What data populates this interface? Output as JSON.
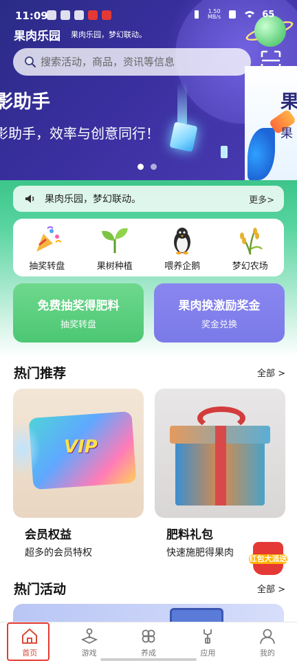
{
  "status_bar": {
    "time": "11:09",
    "net_speed": "1.50",
    "net_unit": "MB/s",
    "battery": "65"
  },
  "header": {
    "brand": "果肉乐园",
    "slogan": "果肉乐园，梦幻联动。"
  },
  "search": {
    "placeholder": "搜索活动，商品，资讯等信息",
    "icon": "search-icon"
  },
  "banner": {
    "title": "影助手",
    "subtitle": "影助手，效率与创意同行！",
    "next_title": "果",
    "next_subtitle": "果",
    "slides": 2,
    "active_slide": 1
  },
  "notice": {
    "text": "果肉乐园，梦幻联动。",
    "more": "更多>"
  },
  "quick_entries": [
    {
      "label": "抽奖转盘",
      "icon": "party-popper-icon"
    },
    {
      "label": "果树种植",
      "icon": "seedling-icon"
    },
    {
      "label": "喂养企鹅",
      "icon": "penguin-icon"
    },
    {
      "label": "梦幻农场",
      "icon": "rice-icon"
    }
  ],
  "promos": [
    {
      "title": "免费抽奖得肥料",
      "subtitle": "抽奖转盘",
      "color": "#5ccf7f"
    },
    {
      "title": "果肉换激励奖金",
      "subtitle": "奖金兑换",
      "color": "#8280ee"
    }
  ],
  "hot_recommend": {
    "title": "热门推荐",
    "more": "全部 >",
    "items": [
      {
        "name": "会员权益",
        "desc": "超多的会员特权",
        "badge": "VIP"
      },
      {
        "name": "肥料礼包",
        "desc": "快速施肥得果肉"
      }
    ]
  },
  "red_packet": {
    "label": "红包大派送"
  },
  "hot_activity": {
    "title": "热门活动",
    "more": "全部 >"
  },
  "tabbar": [
    {
      "label": "首页",
      "icon": "home-icon",
      "active": true
    },
    {
      "label": "游戏",
      "icon": "joystick-icon",
      "active": false
    },
    {
      "label": "养成",
      "icon": "clover-icon",
      "active": false
    },
    {
      "label": "应用",
      "icon": "wrench-icon",
      "active": false
    },
    {
      "label": "我的",
      "icon": "user-icon",
      "active": false
    }
  ],
  "colors": {
    "accent_red": "#d94a3a",
    "hero_purple": "#3a2f9f",
    "green": "#4cc774"
  }
}
